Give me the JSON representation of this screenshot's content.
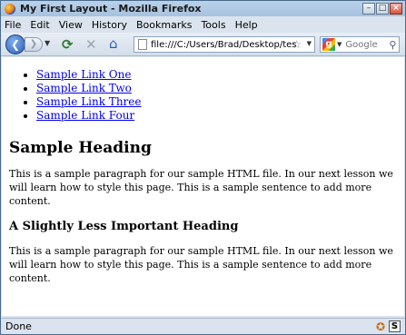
{
  "window": {
    "title": "My First Layout - Mozilla Firefox"
  },
  "menu": [
    "File",
    "Edit",
    "View",
    "History",
    "Bookmarks",
    "Tools",
    "Help"
  ],
  "nav": {
    "url": "file:///C:/Users/Brad/Desktop/test.htm",
    "search_placeholder": "Google"
  },
  "page": {
    "links": [
      "Sample Link One",
      "Sample Link Two",
      "Sample Link Three",
      "Sample Link Four"
    ],
    "heading": "Sample Heading",
    "paragraph1": "This is a sample paragraph for our sample HTML file. In our next lesson we will learn how to style this page. This is a sample sentence to add more content.",
    "subheading": "A Slightly Less Important Heading",
    "paragraph2": "This is a sample paragraph for our sample HTML file. In our next lesson we will learn how to style this page. This is a sample sentence to add more content."
  },
  "status": {
    "text": "Done"
  },
  "icons": [
    "firefox-icon",
    "back-icon",
    "forward-icon",
    "reload-icon",
    "stop-icon",
    "home-icon",
    "page-icon",
    "star-icon",
    "google-icon",
    "magnifier-icon",
    "addon-icon",
    "s-icon"
  ],
  "colors": {
    "link": "#0000ee",
    "chrome": "#dbe4ee"
  }
}
